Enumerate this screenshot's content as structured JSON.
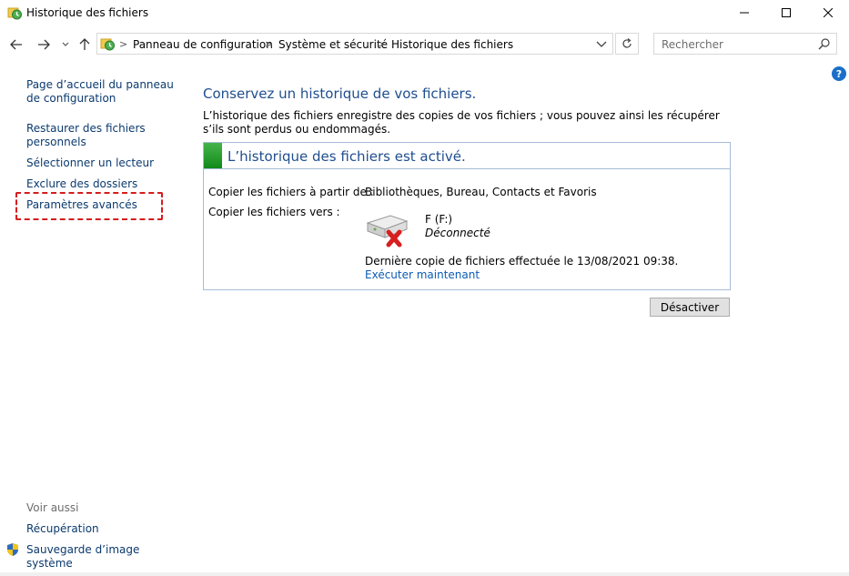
{
  "window": {
    "title": "Historique des fichiers"
  },
  "address": {
    "crumbs": [
      "Panneau de configuration",
      "Système et sécurité",
      "Historique des fichiers"
    ]
  },
  "search": {
    "placeholder": "Rechercher"
  },
  "sidebar": {
    "links": [
      {
        "label": "Page d’accueil du panneau de configuration"
      },
      {
        "label": "Restaurer des fichiers personnels"
      },
      {
        "label": "Sélectionner un lecteur"
      },
      {
        "label": "Exclure des dossiers"
      },
      {
        "label": "Paramètres avancés"
      }
    ],
    "see_also": {
      "title": "Voir aussi",
      "items": [
        {
          "label": "Récupération"
        },
        {
          "label": "Sauvegarde d’image système"
        }
      ]
    }
  },
  "main": {
    "title": "Conservez un historique de vos fichiers.",
    "description": "L’historique des fichiers enregistre des copies de vos fichiers ; vous pouvez ainsi les récupérer s’ils sont perdus ou endommagés.",
    "status": "L’historique des fichiers est activé.",
    "copy_from_label": "Copier les fichiers à partir de :",
    "copy_from_value": "Bibliothèques, Bureau, Contacts et Favoris",
    "copy_to_label": "Copier les fichiers vers :",
    "drive_name": "F (F:)",
    "drive_state": "Déconnecté",
    "last_copy": "Dernière copie de fichiers effectuée le 13/08/2021 09:38.",
    "run_now": "Exécuter maintenant",
    "disable_button": "Désactiver"
  },
  "colors": {
    "link": "#0b3a6e",
    "heading": "#1f4e8f",
    "status_on": "#1e9b26",
    "highlight": "#d41d1d"
  }
}
